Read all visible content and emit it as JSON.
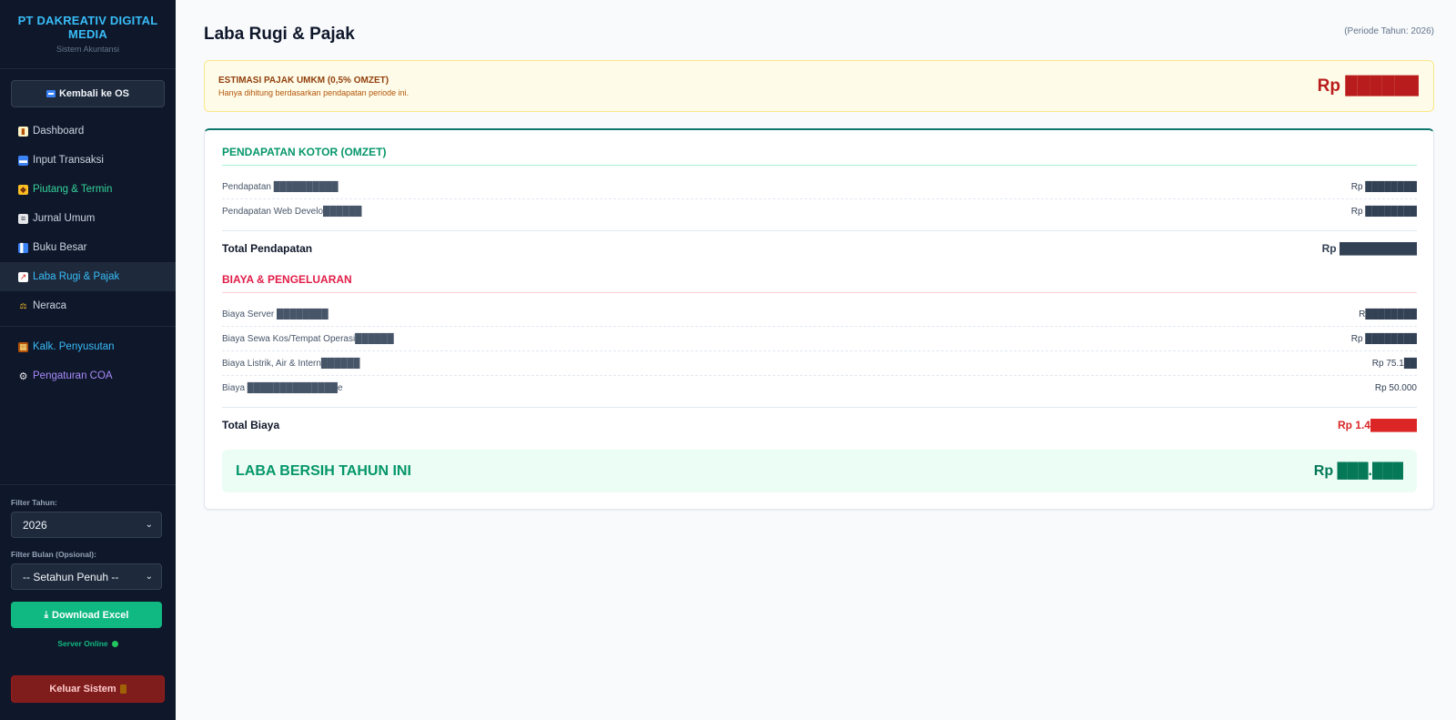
{
  "sidebar": {
    "brand_title": "PT DAKREATIV DIGITAL MEDIA",
    "brand_subtitle": "Sistem Akuntansi",
    "back_button": "Kembali ke OS",
    "nav": [
      {
        "label": "Dashboard",
        "icon": "bar-chart-icon"
      },
      {
        "label": "Input Transaksi",
        "icon": "card-icon"
      },
      {
        "label": "Piutang & Termin",
        "icon": "tag-icon"
      },
      {
        "label": "Jurnal Umum",
        "icon": "notebook-icon"
      },
      {
        "label": "Buku Besar",
        "icon": "book-icon"
      },
      {
        "label": "Laba Rugi & Pajak",
        "icon": "trend-chart-icon"
      },
      {
        "label": "Neraca",
        "icon": "scale-icon"
      }
    ],
    "tools": [
      {
        "label": "Kalk. Penyusutan",
        "icon": "abacus-icon"
      },
      {
        "label": "Pengaturan COA",
        "icon": "gear-icon"
      }
    ],
    "filter_year_label": "Filter Tahun:",
    "filter_year_value": "2026",
    "filter_month_label": "Filter Bulan (Opsional):",
    "filter_month_value": "-- Setahun Penuh --",
    "download_button": "Download Excel",
    "server_status": "Server Online",
    "logout_button": "Keluar Sistem"
  },
  "header": {
    "title": "Laba Rugi & Pajak",
    "period": "(Periode Tahun: 2026)"
  },
  "tax": {
    "title": "ESTIMASI PAJAK UMKM (0,5% OMZET)",
    "description": "Hanya dihitung berdasarkan pendapatan periode ini.",
    "amount": "Rp ██████"
  },
  "income": {
    "title": "PENDAPATAN KOTOR (OMZET)",
    "rows": [
      {
        "label": "Pendapatan ██████████",
        "amount": "Rp ████████"
      },
      {
        "label": "Pendapatan Web Develo██████",
        "amount": "Rp ████████"
      }
    ],
    "total_label": "Total Pendapatan",
    "total_amount": "Rp ██████████"
  },
  "expense": {
    "title": "BIAYA & PENGELUARAN",
    "rows": [
      {
        "label": "Biaya Server ████████",
        "amount": "R████████"
      },
      {
        "label": "Biaya Sewa Kos/Tempat Operasi██████",
        "amount": "Rp ████████"
      },
      {
        "label": "Biaya Listrik, Air & Intern██████",
        "amount": "Rp 75.1██"
      },
      {
        "label": "Biaya ██████████████e",
        "amount": "Rp 50.000"
      }
    ],
    "total_label": "Total Biaya",
    "total_amount": "Rp 1.4██████"
  },
  "net": {
    "label": "LABA BERSIH TAHUN INI",
    "amount": "Rp ███.███"
  },
  "colors": {
    "sidebar_bg": "#0f172a",
    "accent": "#38bdf8",
    "income": "#059669",
    "expense": "#e11d48"
  }
}
